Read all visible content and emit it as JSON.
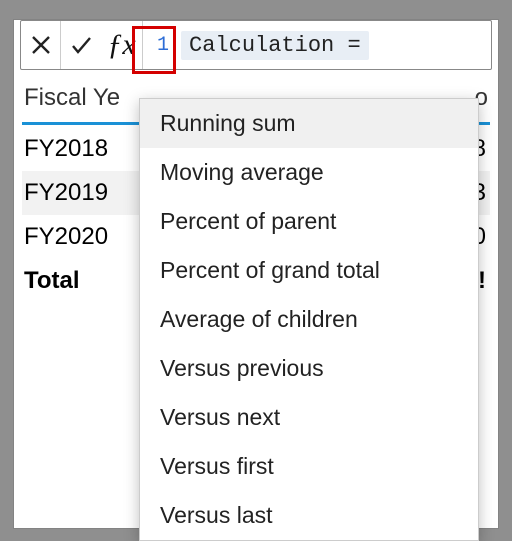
{
  "formula_bar": {
    "line_number": "1",
    "expression": "Calculation =",
    "fx_label": "ƒx"
  },
  "headers": {
    "left": "Fiscal Ye",
    "right_fragment": "o"
  },
  "rows": [
    {
      "label": "FY2018",
      "value_fragment": "8"
    },
    {
      "label": "FY2019",
      "value_fragment": "3"
    },
    {
      "label": "FY2020",
      "value_fragment": "0"
    },
    {
      "label": "Total",
      "value_fragment": "!"
    }
  ],
  "dropdown": {
    "items": [
      "Running sum",
      "Moving average",
      "Percent of parent",
      "Percent of grand total",
      "Average of children",
      "Versus previous",
      "Versus next",
      "Versus first",
      "Versus last"
    ],
    "active_index": 0
  }
}
